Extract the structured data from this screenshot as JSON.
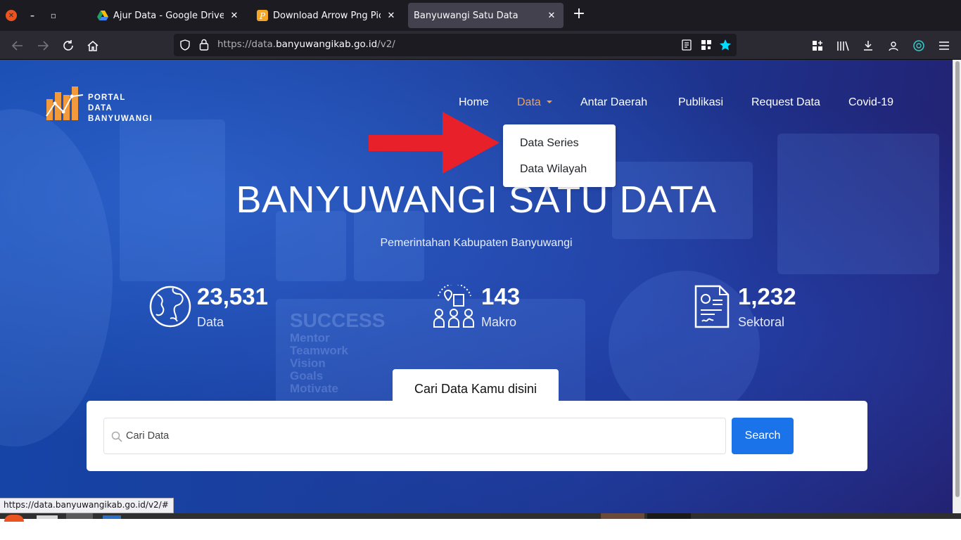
{
  "browser": {
    "tabs": [
      {
        "title": "Ajur Data - Google Drive",
        "active": false
      },
      {
        "title": "Download Arrow Png Pic HQ",
        "active": false
      },
      {
        "title": "Banyuwangi Satu Data",
        "active": true
      }
    ],
    "url_prefix": "https://data.",
    "url_domain": "banyuwangikab.go.id",
    "url_suffix": "/v2/",
    "status_url": "https://data.banyuwangikab.go.id/v2/#"
  },
  "site": {
    "logo_lines": [
      "PORTAL",
      "DATA",
      "BANYUWANGI"
    ],
    "nav": {
      "home": "Home",
      "data": "Data",
      "antar_daerah": "Antar Daerah",
      "publikasi": "Publikasi",
      "request_data": "Request Data",
      "covid": "Covid-19"
    },
    "dropdown": [
      "Data Series",
      "Data Wilayah"
    ],
    "hero_title": "BANYUWANGI SATU DATA",
    "hero_subtitle": "Pemerintahan Kabupaten Banyuwangi",
    "stats": [
      {
        "value": "23,531",
        "label": "Data",
        "icon": "globe-icon"
      },
      {
        "value": "143",
        "label": "Makro",
        "icon": "people-building-icon"
      },
      {
        "value": "1,232",
        "label": "Sektoral",
        "icon": "document-icon"
      }
    ],
    "search": {
      "tab_label": "Cari Data Kamu disini",
      "placeholder": "Cari Data",
      "button": "Search"
    },
    "background_words": [
      "SUCCESS",
      "Mentor",
      "Teamwork",
      "Vision",
      "Goals",
      "Motivate"
    ]
  },
  "colors": {
    "accent_orange": "#f5a04a",
    "search_button": "#1a73e8",
    "arrow_red": "#e8202a"
  }
}
